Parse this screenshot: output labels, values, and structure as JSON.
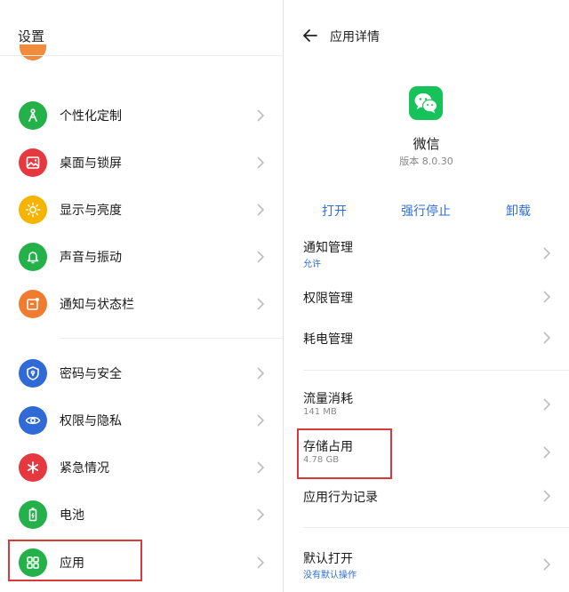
{
  "left": {
    "title": "设置",
    "items": [
      {
        "label": "个性化定制",
        "color": "#24b14a",
        "icon": "personalize-icon"
      },
      {
        "label": "桌面与锁屏",
        "color": "#e5393f",
        "icon": "image-icon"
      },
      {
        "label": "显示与亮度",
        "color": "#f5b400",
        "icon": "sun-icon"
      },
      {
        "label": "声音与振动",
        "color": "#24b14a",
        "icon": "bell-icon"
      },
      {
        "label": "通知与状态栏",
        "color": "#f07d2f",
        "icon": "notification-icon"
      },
      {
        "label": "密码与安全",
        "color": "#2f6ad6",
        "icon": "shield-icon"
      },
      {
        "label": "权限与隐私",
        "color": "#2f6ad6",
        "icon": "eye-icon"
      },
      {
        "label": "紧急情况",
        "color": "#e5393f",
        "icon": "asterisk-icon"
      },
      {
        "label": "电池",
        "color": "#24b14a",
        "icon": "battery-icon"
      },
      {
        "label": "应用",
        "color": "#24b14a",
        "icon": "apps-grid-icon"
      }
    ]
  },
  "right": {
    "title": "应用详情",
    "app": {
      "name": "微信",
      "version": "版本 8.0.30",
      "icon_color": "#16c35a"
    },
    "actions": {
      "open": "打开",
      "force_stop": "强行停止",
      "uninstall": "卸载"
    },
    "items": [
      {
        "label": "通知管理",
        "sub": "允许",
        "sub_color": "#2f6fd8"
      },
      {
        "label": "权限管理",
        "sub": ""
      },
      {
        "label": "耗电管理",
        "sub": ""
      },
      {
        "label": "流量消耗",
        "sub": "141 MB",
        "sub_color": "#888888"
      },
      {
        "label": "存储占用",
        "sub": "4.78 GB",
        "sub_color": "#888888"
      },
      {
        "label": "应用行为记录",
        "sub": ""
      },
      {
        "label": "默认打开",
        "sub": "没有默认操作",
        "sub_color": "#2f6fd8"
      }
    ]
  },
  "colors": {
    "accent": "#2f6fd8",
    "highlight": "#d9393b"
  }
}
